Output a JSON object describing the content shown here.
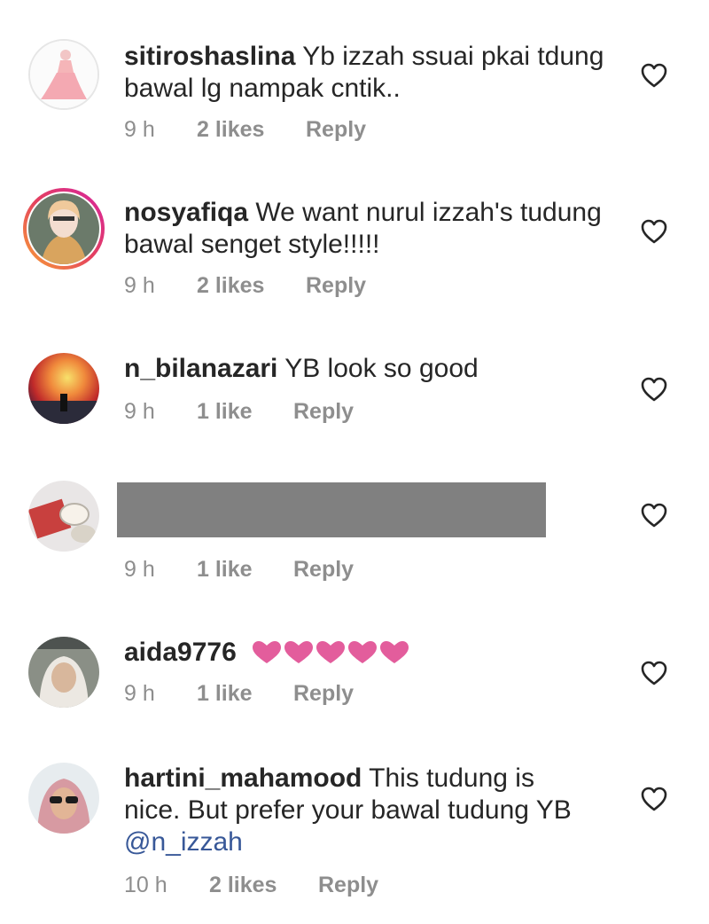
{
  "comments": [
    {
      "username": "sitiroshaslina",
      "text": "Yb izzah ssuai pkai tdung bawal lg nampak cntik..",
      "time": "9 h",
      "likes": "2 likes",
      "reply": "Reply"
    },
    {
      "username": "nosyafiqa",
      "text": "We want nurul izzah's tudung bawal senget style!!!!!",
      "time": "9 h",
      "likes": "2 likes",
      "reply": "Reply"
    },
    {
      "username": "n_bilanazari",
      "text": "YB look so good",
      "time": "9 h",
      "likes": "1 like",
      "reply": "Reply"
    },
    {
      "username": "",
      "text": "",
      "time": "9 h",
      "likes": "1 like",
      "reply": "Reply"
    },
    {
      "username": "aida9776",
      "text": "",
      "emoji": "heart x5",
      "time": "9 h",
      "likes": "1 like",
      "reply": "Reply"
    },
    {
      "username": "hartini_mahamood",
      "text": "This tudung is nice. But prefer your bawal tudung YB",
      "mention": "@n_izzah",
      "time": "10 h",
      "likes": "2 likes",
      "reply": "Reply"
    }
  ],
  "icons": {
    "like": "heart-outline-icon",
    "emoji": "pink-heart-emoji"
  },
  "colors": {
    "mention": "#385898",
    "meta": "#8e8e8e",
    "emoji": "#e35d9c",
    "redaction": "#808080"
  }
}
